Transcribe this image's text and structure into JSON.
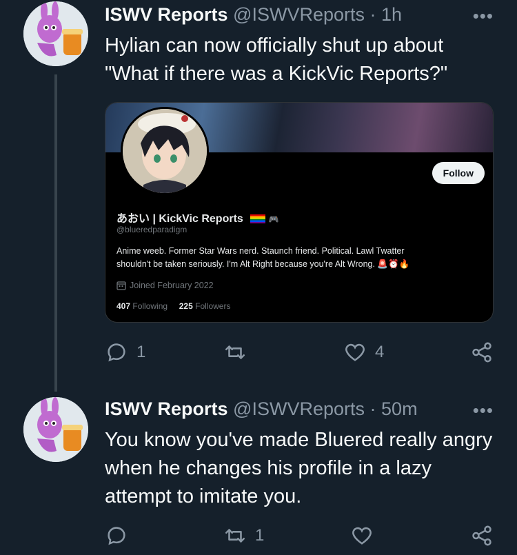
{
  "tweets": [
    {
      "name": "ISWV Reports",
      "handle": "@ISWVReports",
      "separator": "·",
      "time": "1h",
      "more": "•••",
      "lines": [
        "Hylian can now officially shut up about",
        "\"What if there was a KickVic Reports?\""
      ],
      "reply_count": "1",
      "retweet_count": "",
      "like_count": "4"
    },
    {
      "name": "ISWV Reports",
      "handle": "@ISWVReports",
      "separator": "·",
      "time": "50m",
      "more": "•••",
      "lines": [
        "You know you've made Bluered really angry",
        "when he changes his profile in a lazy",
        "attempt to imitate you."
      ],
      "reply_count": "",
      "retweet_count": "1",
      "like_count": ""
    }
  ],
  "embedded_profile": {
    "follow_label": "Follow",
    "display_name": "あおい | KickVic Reports",
    "name_emoji": "🎮",
    "handle": "@blueredparadigm",
    "bio_lines": [
      "Anime weeb. Former Star Wars nerd. Staunch friend. Political. Lawl Twatter",
      "shouldn't be taken seriously. I'm Alt Right because you're Alt Wrong. 🚨⏰🔥"
    ],
    "joined": "Joined February 2022",
    "following_count": "407",
    "following_label": "Following",
    "followers_count": "225",
    "followers_label": "Followers"
  },
  "colors": {
    "background": "#15202b",
    "muted": "#8b98a5",
    "text": "#f7f9f9"
  }
}
